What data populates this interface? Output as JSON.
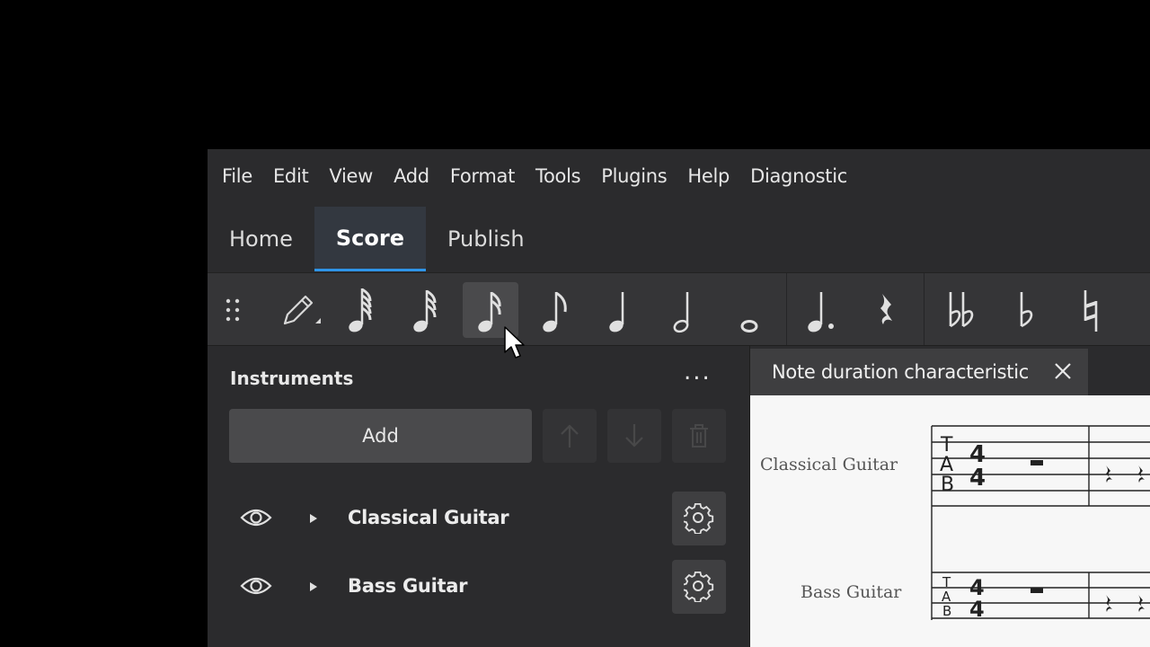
{
  "menu": [
    "File",
    "Edit",
    "View",
    "Add",
    "Format",
    "Tools",
    "Plugins",
    "Help",
    "Diagnostic"
  ],
  "tabs": [
    {
      "label": "Home",
      "active": false
    },
    {
      "label": "Score",
      "active": true
    },
    {
      "label": "Publish",
      "active": false
    }
  ],
  "toolbar": {
    "icons": [
      "drag-handle-icon",
      "pencil-note-input-icon",
      "sixty-fourth-note-icon",
      "thirty-second-note-icon",
      "sixteenth-note-icon",
      "eighth-note-icon",
      "quarter-note-icon",
      "half-note-icon",
      "whole-note-icon",
      "augmentation-dot-icon",
      "rest-icon",
      "double-flat-icon",
      "flat-icon",
      "natural-icon"
    ],
    "hovered": "sixteenth-note-icon"
  },
  "instruments_panel": {
    "title": "Instruments",
    "more_label": "...",
    "add_label": "Add",
    "items": [
      {
        "name": "Classical Guitar"
      },
      {
        "name": "Bass Guitar"
      }
    ]
  },
  "score": {
    "tab_label": "Note duration characteristic",
    "staves": [
      {
        "name": "Classical Guitar",
        "tab_letters": [
          "T",
          "A",
          "B"
        ],
        "time_signature": "4/4"
      },
      {
        "name": "Bass Guitar",
        "tab_letters": [
          "T",
          "A",
          "B"
        ],
        "time_signature": "4/4"
      }
    ]
  },
  "colors": {
    "accent": "#2f95e8",
    "background": "#2b2b2d",
    "toolbar": "#353537",
    "paper": "#f7f7f7"
  }
}
